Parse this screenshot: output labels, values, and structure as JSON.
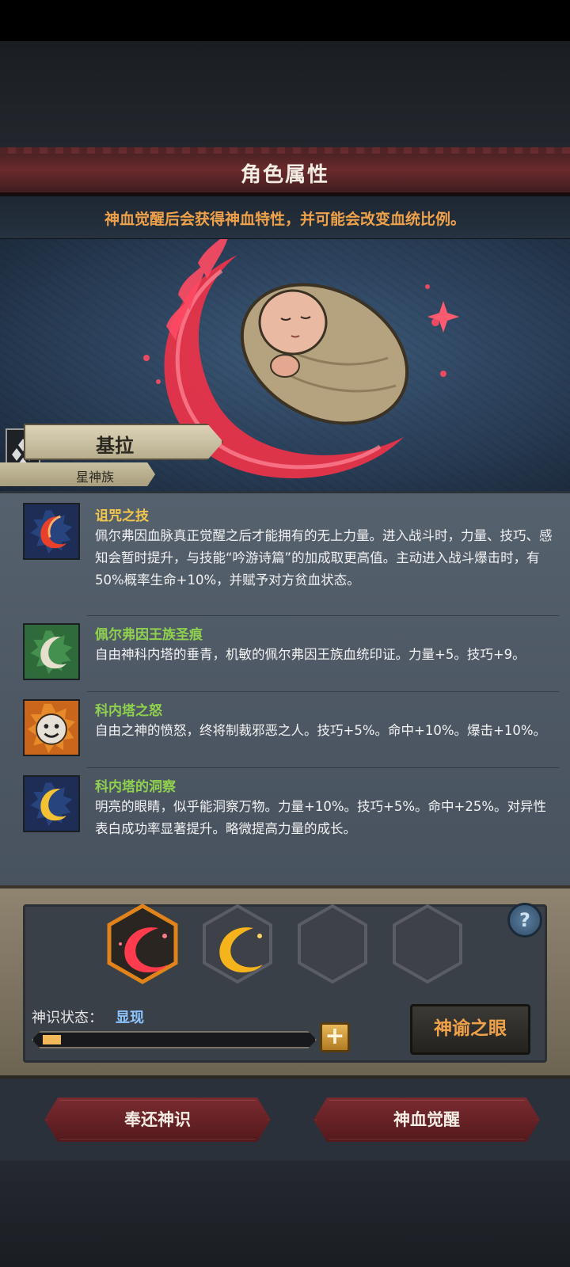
{
  "header": {
    "title": "角色属性"
  },
  "hint": "神血觉醒后会获得神血特性，并可能会改变血统比例。",
  "character": {
    "name": "基拉",
    "race": "星神族"
  },
  "traits": [
    {
      "icon": "red-crescent-icon",
      "title": "诅咒之技",
      "title_color": "#f1c64a",
      "desc": "佩尔弗因血脉真正觉醒之后才能拥有的无上力量。进入战斗时，力量、技巧、感知会暂时提升，与技能“吟游诗篇”的加成取更高值。主动进入战斗爆击时，有50%概率生命+10%，并赋予对方贫血状态。"
    },
    {
      "icon": "white-crescent-icon",
      "title": "佩尔弗因王族圣痕",
      "title_color": "#8fd14f",
      "desc": "自由神科内塔的垂青，机敏的佩尔弗因王族血统印证。力量+5。技巧+9。"
    },
    {
      "icon": "angry-face-icon",
      "title": "科内塔之怒",
      "title_color": "#8fd14f",
      "desc": "自由之神的愤怒，终将制裁邪恶之人。技巧+5%。命中+10%。爆击+10%。"
    },
    {
      "icon": "gold-crescent-icon",
      "title": "科内塔的洞察",
      "title_color": "#8fd14f",
      "desc": "明亮的眼睛，似乎能洞察万物。力量+10%。技巧+5%。命中+25%。对异性表白成功率显著提升。略微提高力量的成长。"
    }
  ],
  "divine": {
    "status_label": "神识状态：",
    "status_value": "显现",
    "progress": 0.07,
    "plus_label": "+",
    "help_label": "?",
    "oracle_button": "神谕之眼",
    "slots": [
      "red-swirl-icon",
      "gold-swirl-icon",
      "empty-slot",
      "empty-slot"
    ]
  },
  "actions": {
    "return_button": "奉还神识",
    "awaken_button": "神血觉醒"
  },
  "colors": {
    "accent": "#f0a24a",
    "status_blue": "#8cc4ff",
    "button_red": "#7a2b30"
  }
}
